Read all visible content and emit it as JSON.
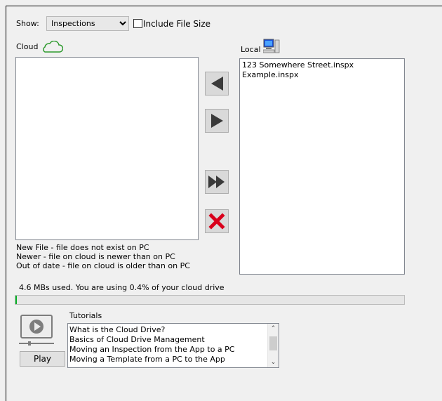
{
  "top": {
    "show_label": "Show:",
    "show_value": "Inspections",
    "show_options": [
      "Inspections"
    ],
    "include_file_size_label": "Include File Size",
    "include_file_size_checked": false
  },
  "cloud": {
    "label": "Cloud",
    "icon": "cloud-icon",
    "items": []
  },
  "local": {
    "label": "Local",
    "icon": "computer-icon",
    "items": [
      "123 Somewhere Street.inspx",
      "Example.inspx"
    ]
  },
  "transfer_buttons": {
    "to_cloud": "arrow-left-icon",
    "to_local": "arrow-right-icon",
    "sync_all": "double-arrow-right-icon",
    "delete": "red-x-icon"
  },
  "legend": [
    "New File - file does not exist on PC",
    "Newer - file on cloud is newer than on PC",
    "Out of date - file on cloud is older than on PC"
  ],
  "usage": {
    "text": "4.6 MBs used. You are using  0.4% of your cloud drive",
    "percent": 0.4
  },
  "tutorials": {
    "label": "Tutorials",
    "play_label": "Play",
    "icon": "video-player-icon",
    "items": [
      "What is the Cloud Drive?",
      "Basics of Cloud Drive Management",
      "Moving an Inspection from the App to a PC",
      "Moving a Template from a PC to the App"
    ]
  },
  "colors": {
    "arrow": "#3a3a3a",
    "delete": "#d9001b",
    "cloud_icon": "#2e9a2e"
  }
}
